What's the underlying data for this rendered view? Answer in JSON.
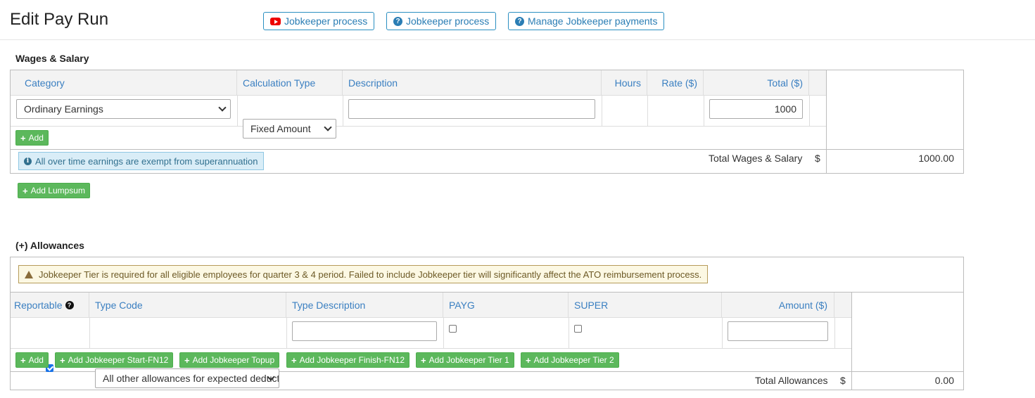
{
  "header": {
    "title": "Edit Pay Run",
    "buttons": [
      {
        "label": "Jobkeeper process",
        "icon": "youtube-icon"
      },
      {
        "label": "Jobkeeper process",
        "icon": "question-circle-icon"
      },
      {
        "label": "Manage Jobkeeper payments",
        "icon": "question-circle-icon"
      }
    ]
  },
  "wages": {
    "title": "Wages & Salary",
    "columns": {
      "category": "Category",
      "calc_type": "Calculation Type",
      "description": "Description",
      "hours": "Hours",
      "rate": "Rate ($)",
      "total": "Total ($)"
    },
    "row": {
      "category": "Ordinary Earnings",
      "calc_type": "Fixed Amount",
      "description": "",
      "total": "1000"
    },
    "add_label": "Add",
    "info": "All over time earnings are exempt from superannuation",
    "total_label": "Total Wages & Salary",
    "currency": "$",
    "total_value": "1000.00",
    "add_lumpsum_label": "Add Lumpsum"
  },
  "allowances": {
    "title": "(+) Allowances",
    "warning": "Jobkeeper Tier is required for all eligible employees for quarter 3 & 4 period. Failed to include Jobkeeper tier will significantly affect the ATO reimbursement process.",
    "columns": {
      "reportable": "Reportable",
      "type_code": "Type Code",
      "type_description": "Type Description",
      "payg": "PAYG",
      "super": "SUPER",
      "amount": "Amount ($)"
    },
    "row": {
      "reportable": true,
      "type_code": "All other allowances for expected deductions",
      "type_description": "",
      "payg": false,
      "super": false,
      "amount": ""
    },
    "buttons": [
      "Add",
      "Add Jobkeeper Start-FN12",
      "Add Jobkeeper Topup",
      "Add Jobkeeper Finish-FN12",
      "Add Jobkeeper Tier 1",
      "Add Jobkeeper Tier 2"
    ],
    "total_label": "Total Allowances",
    "currency": "$",
    "total_value": "0.00"
  },
  "colors": {
    "accent": "#3a7fc1",
    "success": "#5cb85c",
    "info_bg": "#d9edf7",
    "warning_bg": "#fcf8e3"
  }
}
